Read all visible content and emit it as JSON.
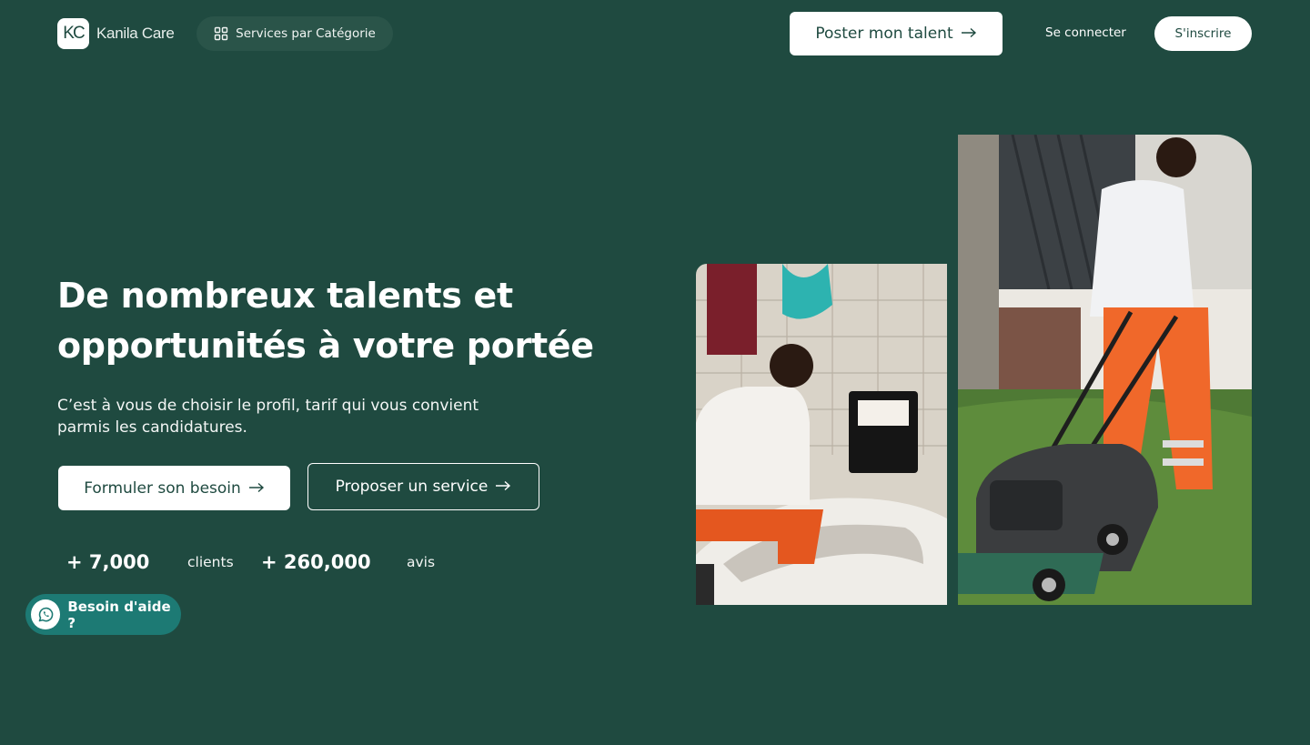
{
  "header": {
    "logo_mark": "KC",
    "logo_text": "Kanila Care",
    "categories_label": "Services par Catégorie",
    "post_talent_label": "Poster mon talent",
    "login_label": "Se connecter",
    "signup_label": "S'inscrire"
  },
  "hero": {
    "title_line1": "De nombreux talents et",
    "title_line2": "opportunités à votre portée",
    "subtitle_line1": "C’est à vous de choisir le profil, tarif qui vous convient",
    "subtitle_line2": "parmis les candidatures.",
    "cta_primary": "Formuler son besoin",
    "cta_secondary": "Proposer un service"
  },
  "stats": [
    {
      "value": "+ 7,000",
      "label": "clients"
    },
    {
      "value": "+ 260,000",
      "label": "avis"
    }
  ],
  "help": {
    "label": "Besoin d'aide ?"
  },
  "icons": {
    "categories": "grid-icon",
    "arrow": "arrow-right-icon",
    "whatsapp": "whatsapp-icon"
  },
  "images": {
    "photo_1": "plumber-repairing-bathtub",
    "photo_2": "worker-mowing-lawn"
  },
  "colors": {
    "background": "#1f4a40",
    "accent": "#1d7a74",
    "button_bg": "#ffffff",
    "button_text": "#1f4a40"
  }
}
